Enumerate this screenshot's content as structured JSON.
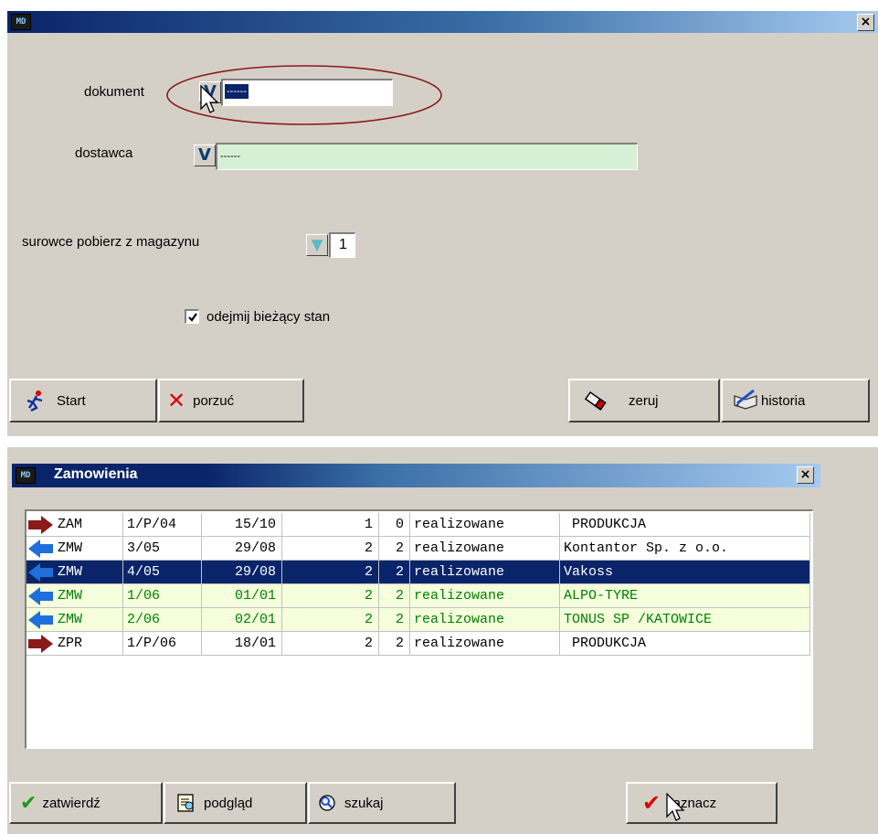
{
  "main_window": {
    "close_label": "×",
    "icon_text": "MD",
    "labels": {
      "dokument": "dokument",
      "dostawca": "dostawca",
      "surowce": "surowce pobierz z magazynu",
      "odejmij": "odejmij bieżący stan"
    },
    "fields": {
      "dokument_value": "------",
      "dostawca_value": "------",
      "magazyn_value": "1"
    },
    "v_glyph": "V",
    "checkbox_checked": true,
    "buttons": {
      "start": "Start",
      "porzuc": "porzuć",
      "zeruj": "zeruj",
      "historia": "historia"
    }
  },
  "orders_window": {
    "title": "Zamowienia",
    "icon_text": "MD",
    "close_label": "×",
    "rows": [
      {
        "type": "ZAM",
        "num": "1/P/04",
        "date": "15/10",
        "a": "1",
        "b": "0",
        "status": "realizowane",
        "party": " PRODUKCJA",
        "arrow": "right",
        "style": "normal"
      },
      {
        "type": "ZMW",
        "num": "3/05",
        "date": "29/08",
        "a": "2",
        "b": "2",
        "status": "realizowane",
        "party": "Kontantor Sp. z o.o.",
        "arrow": "left",
        "style": "normal"
      },
      {
        "type": "ZMW",
        "num": "4/05",
        "date": "29/08",
        "a": "2",
        "b": "2",
        "status": "realizowane",
        "party": "Vakoss",
        "arrow": "left",
        "style": "selected"
      },
      {
        "type": "ZMW",
        "num": "1/06",
        "date": "01/01",
        "a": "2",
        "b": "2",
        "status": "realizowane",
        "party": "ALPO-TYRE",
        "arrow": "left",
        "style": "green"
      },
      {
        "type": "ZMW",
        "num": "2/06",
        "date": "02/01",
        "a": "2",
        "b": "2",
        "status": "realizowane",
        "party": "TONUS SP /KATOWICE",
        "arrow": "left",
        "style": "green"
      },
      {
        "type": "ZPR",
        "num": "1/P/06",
        "date": "18/01",
        "a": "2",
        "b": "2",
        "status": "realizowane",
        "party": " PRODUKCJA",
        "arrow": "right",
        "style": "normal"
      }
    ],
    "buttons": {
      "zatwierdz": "zatwierdź",
      "podglad": "podgląd",
      "szukaj": "szukaj",
      "zaznacz": "zaznacz"
    }
  },
  "colors": {
    "window_bg": "#d4d0c8",
    "title_active": "#0a246a",
    "selection": "#0a246a",
    "green_row_bg": "#f5ffdc",
    "green_text": "#008000",
    "dostawca_bg": "#d6f0d6",
    "arrow_right": "#8b1a1a",
    "arrow_left": "#1e6fd9",
    "check_red": "#e00000",
    "check_green": "#1a9a1a",
    "annotation_ellipse": "#8b1a1a"
  }
}
